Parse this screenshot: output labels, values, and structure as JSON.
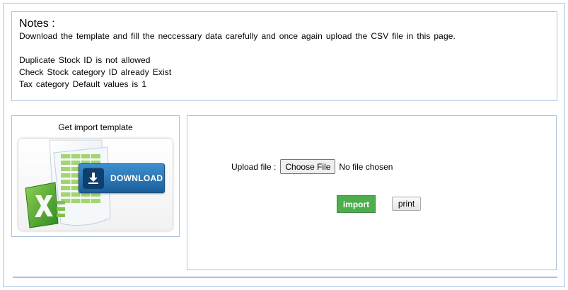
{
  "notes": {
    "title": "Notes :",
    "lines": [
      "Download the template and fill the neccessary data carefully and once again upload the CSV file in this page.",
      "Duplicate Stock ID is not allowed",
      "Check Stock category ID already Exist",
      "Tax category Default values is 1"
    ]
  },
  "template": {
    "heading": "Get import template",
    "download_label": "DOWNLOAD"
  },
  "upload": {
    "label": "Upload file :",
    "choose_label": "Choose File",
    "status": "No file chosen",
    "import_label": "import",
    "print_label": "print"
  },
  "colors": {
    "border": "#a9c1e0",
    "import_green": "#4cae4c",
    "download_blue": "#2a75b8"
  }
}
